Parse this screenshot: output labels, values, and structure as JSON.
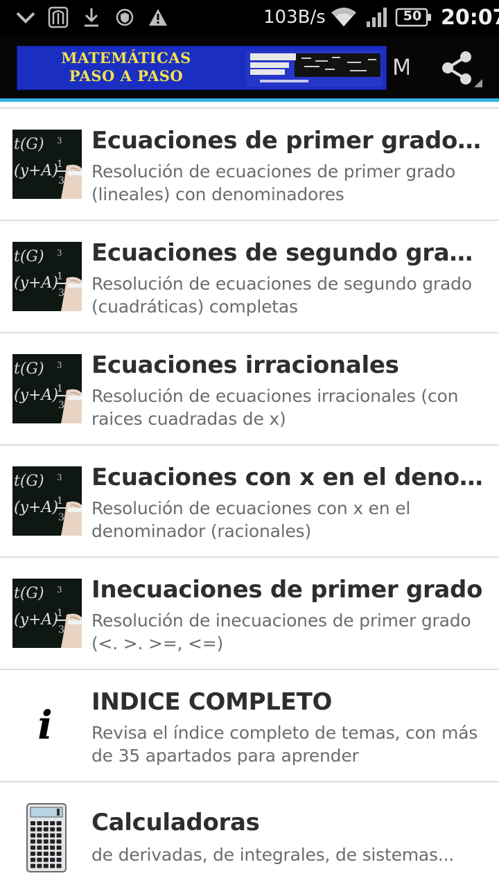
{
  "status_bar": {
    "icons": [
      "chevron-down-icon",
      "notification-app-icon",
      "download-icon",
      "shield-icon",
      "warning-icon",
      "wifi-icon",
      "signal-icon",
      "battery-icon"
    ],
    "net_speed": "103B/s",
    "battery_level": "50",
    "time": "20:07"
  },
  "action_bar": {
    "banner_title_line1": "MATEMÁTICAS",
    "banner_title_line2": "PASO A PASO",
    "title_truncated": "M",
    "share_icon": "share-icon",
    "accent_color": "#33b5e5"
  },
  "list": {
    "items": [
      {
        "title": "Ecuaciones de primer grado con denominadores",
        "subtitle": "Resolución de ecuaciones de primer grado (lineales) con denominadores",
        "icon": "chalkboard-thumbnail"
      },
      {
        "title": "Ecuaciones de segundo grado completas",
        "subtitle": "Resolución de ecuaciones de segundo grado (cuadráticas) completas",
        "icon": "chalkboard-thumbnail"
      },
      {
        "title": "Ecuaciones irracionales",
        "subtitle": "Resolución de ecuaciones irracionales (con raices cuadradas de x)",
        "icon": "chalkboard-thumbnail"
      },
      {
        "title": "Ecuaciones con x en el denominador",
        "subtitle": "Resolución de ecuaciones con x en el denominador (racionales)",
        "icon": "chalkboard-thumbnail"
      },
      {
        "title": "Inecuaciones de primer grado",
        "subtitle": "Resolución de inecuaciones de primer grado (<. >. >=, <=)",
        "icon": "chalkboard-thumbnail"
      },
      {
        "title": "INDICE COMPLETO",
        "subtitle": "Revisa el índice completo de temas, con más de 35 apartados para aprender",
        "icon": "info-icon",
        "icon_glyph": "i"
      },
      {
        "title": "Calculadoras",
        "subtitle": "de derivadas, de integrales, de sistemas...",
        "icon": "calculator-icon"
      }
    ]
  }
}
